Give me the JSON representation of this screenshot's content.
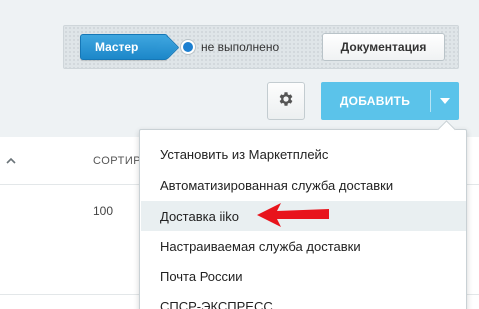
{
  "toolbar": {
    "master_label": "Мастер",
    "status_text": "не выполнено",
    "docs_label": "Документация"
  },
  "actions": {
    "settings_icon": "gear-icon",
    "add_label": "ДОБАВИТЬ",
    "add_caret_icon": "caret-down-icon"
  },
  "table": {
    "sort_icon": "chevron-up-icon",
    "column_header": "СОРТИР",
    "rows": [
      {
        "sort": "100"
      }
    ]
  },
  "dropdown": {
    "items": [
      {
        "label": "Установить из Маркетплейс"
      },
      {
        "label": "Автоматизированная служба доставки"
      },
      {
        "label": "Доставка iiko"
      },
      {
        "label": "Настраиваемая служба доставки"
      },
      {
        "label": "Почта России"
      },
      {
        "label": "СПСР-ЭКСПРЕСС"
      }
    ],
    "highlighted_index": 2
  },
  "annotation": {
    "arrow_icon": "red-arrow-icon",
    "arrow_color": "#e8141c"
  },
  "colors": {
    "primary": "#1c87c9",
    "add_button": "#5bc3ea",
    "status_dot": "#1c7fd0"
  }
}
